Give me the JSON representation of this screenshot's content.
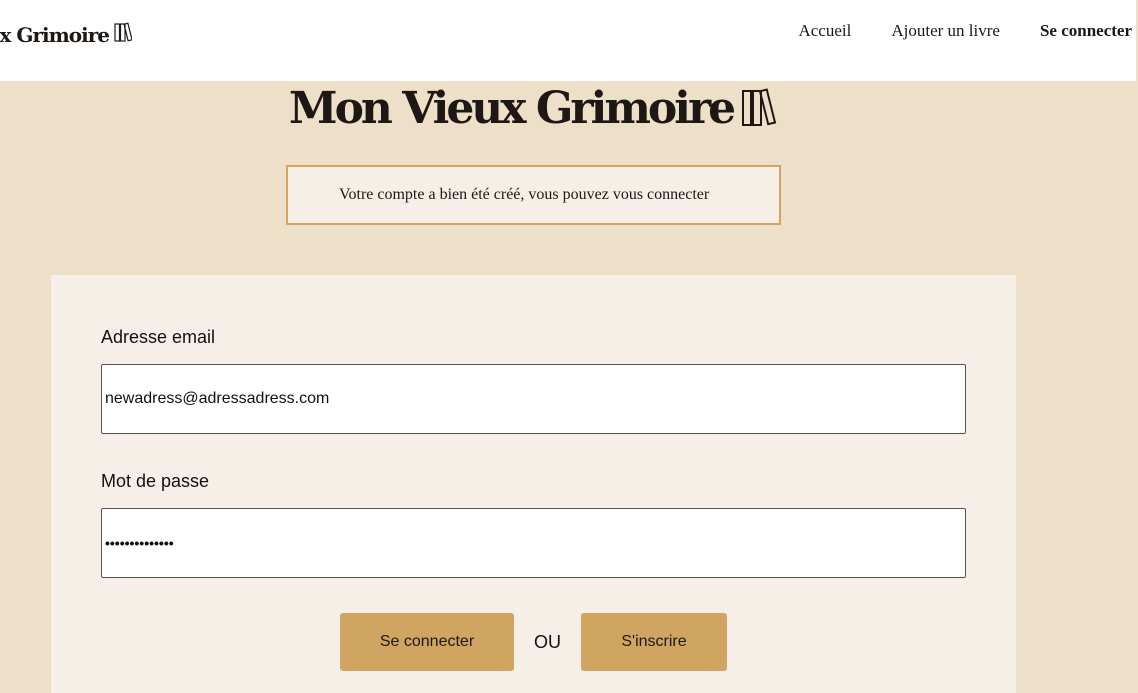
{
  "header": {
    "logo_text": "Mon Vieux Grimoire",
    "logo_icon": "books-icon",
    "nav": [
      {
        "label": "Accueil",
        "active": false
      },
      {
        "label": "Ajouter un livre",
        "active": false
      },
      {
        "label": "Se connecter",
        "active": true
      }
    ]
  },
  "page": {
    "title": "Mon Vieux Grimoire",
    "title_icon": "books-icon",
    "notice": "Votre compte a bien été créé, vous pouvez vous connecter"
  },
  "form": {
    "email_label": "Adresse email",
    "email_value": "newadress@adressadress.com",
    "password_label": "Mot de passe",
    "password_value": "••••••••••••••",
    "login_label": "Se connecter",
    "or_label": "OU",
    "signup_label": "S'inscrire"
  },
  "colors": {
    "page_background": "#eddfc8",
    "panel_background": "#f5efe8",
    "accent": "#d0a461",
    "text": "#1e1814"
  }
}
